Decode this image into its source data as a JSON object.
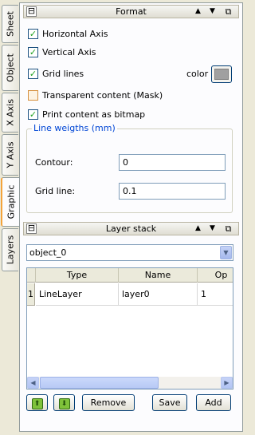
{
  "side_tabs": [
    {
      "label": "Sheet",
      "active": false
    },
    {
      "label": "Object",
      "active": false
    },
    {
      "label": "X Axis",
      "active": false
    },
    {
      "label": "Y Axis",
      "active": false
    },
    {
      "label": "Graphic",
      "active": true
    },
    {
      "label": "Layers",
      "active": false
    }
  ],
  "format_panel": {
    "title": "Format",
    "checkboxes": [
      {
        "label": "Horizontal Axis",
        "checked": true
      },
      {
        "label": "Vertical Axis",
        "checked": true
      },
      {
        "label": "Grid lines",
        "checked": true
      },
      {
        "label": "Transparent content (Mask)",
        "checked": false
      },
      {
        "label": "Print content as bitmap",
        "checked": true
      }
    ],
    "color_label": "color",
    "color_value": "#a0a0a0",
    "line_weights": {
      "legend": "Line weigths (mm)",
      "contour_label": "Contour:",
      "contour_value": "0",
      "gridline_label": "Grid line:",
      "gridline_value": "0.1"
    }
  },
  "layer_panel": {
    "title": "Layer stack",
    "object_select": "object_0",
    "columns": [
      "Type",
      "Name",
      "Op"
    ],
    "rows": [
      {
        "index": "1",
        "type": "LineLayer",
        "name": "layer0",
        "op": "1"
      }
    ]
  },
  "buttons": {
    "up_icon": "arrow-up-icon",
    "down_icon": "arrow-down-icon",
    "remove": "Remove",
    "save": "Save",
    "add": "Add"
  },
  "glyphs": {
    "collapse": "⊟",
    "up": "▲",
    "down": "▼",
    "restore": "⧉",
    "check": "✓",
    "combo_arrow": "▼",
    "scroll_left": "◀",
    "scroll_right": "▶",
    "arrow_up": "⬆",
    "arrow_down": "⬇"
  }
}
